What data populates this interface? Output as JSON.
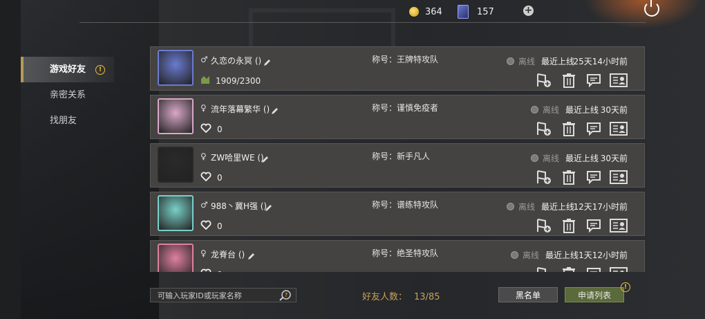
{
  "header": {
    "gold": "364",
    "cards": "157",
    "icons": {
      "gold": "gold-coin-icon",
      "cards": "card-icon",
      "add": "plus-icon",
      "power": "power-icon"
    }
  },
  "sidebar": {
    "items": [
      {
        "label": "游戏好友",
        "active": true,
        "alert": true
      },
      {
        "label": "亲密关系",
        "active": false
      },
      {
        "label": "找朋友",
        "active": false
      }
    ]
  },
  "friends": [
    {
      "gender": "♂",
      "name": "久恋の永冥 ()",
      "sub_icon": "rank-icon",
      "sub_value": "1909/2300",
      "title": "称号：王牌特攻队",
      "status": "离线",
      "last_label": "最近上线",
      "last_value": "25天14小时前",
      "avatar_color": "#6a7bd0"
    },
    {
      "gender": "♀",
      "name": "流年落幕繁华 ()",
      "sub_icon": "heart-icon",
      "sub_value": "0",
      "title": "称号：谨慎免疫者",
      "status": "离线",
      "last_label": "最近上线",
      "last_value": "30天前",
      "avatar_color": "#d8a8c8"
    },
    {
      "gender": "♀",
      "name": "ZW哈里WE ()",
      "sub_icon": "heart-icon",
      "sub_value": "0",
      "title": "称号：新手凡人",
      "status": "离线",
      "last_label": "最近上线",
      "last_value": "30天前",
      "avatar_color": "#2a2a2a"
    },
    {
      "gender": "♂",
      "name": "988丶冀H强 ()",
      "sub_icon": "heart-icon",
      "sub_value": "0",
      "title": "称号：谱练特攻队",
      "status": "离线",
      "last_label": "最近上线",
      "last_value": "12天17小时前",
      "avatar_color": "#7ad0c8"
    },
    {
      "gender": "♀",
      "name": "龙脊台 ()",
      "sub_icon": "heart-icon",
      "sub_value": "0",
      "title": "称号：绝圣特攻队",
      "status": "离线",
      "last_label": "最近上线",
      "last_value": "1天12小时前",
      "avatar_color": "#e080a0"
    }
  ],
  "actions": [
    "add-map-icon",
    "trash-icon",
    "chat-icon",
    "profile-card-icon"
  ],
  "bottom": {
    "search_placeholder": "可输入玩家ID或玩家名称",
    "count_label": "好友人数：",
    "count_value": "13/85",
    "blacklist_label": "黑名单",
    "apply_label": "申请列表"
  }
}
